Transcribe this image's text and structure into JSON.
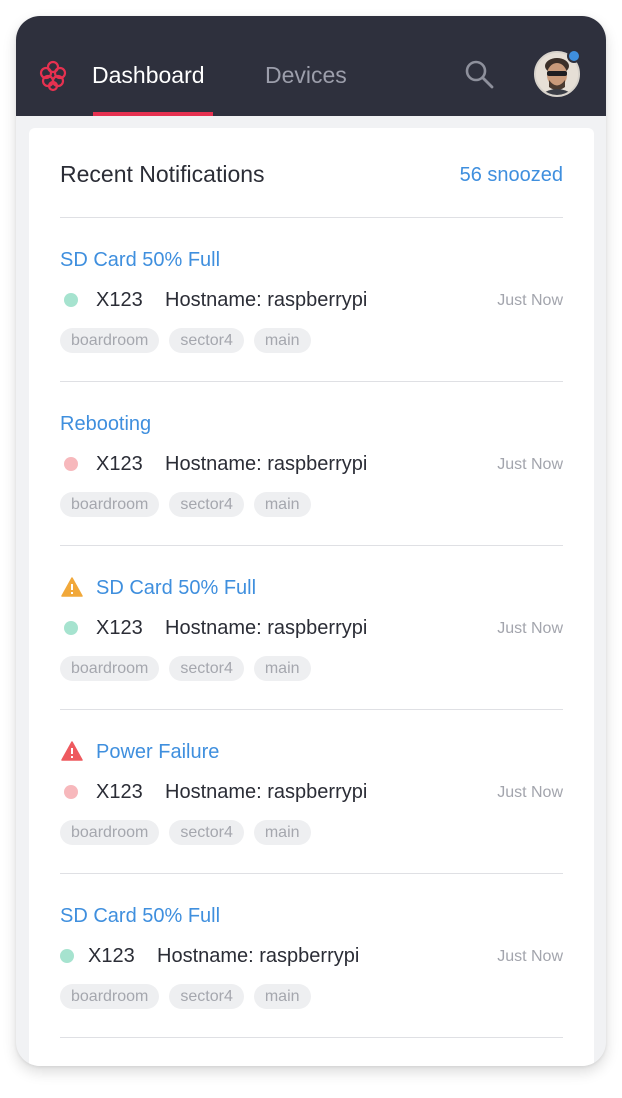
{
  "nav": {
    "tabs": [
      {
        "label": "Dashboard",
        "active": true
      },
      {
        "label": "Devices",
        "active": false
      }
    ],
    "logo_icon": "raspberry-logo-icon",
    "search_icon": "search-icon",
    "avatar_icon": "user-avatar",
    "accent_color": "#e63150",
    "notification_dot_color": "#3f8fde"
  },
  "notifications": {
    "title": "Recent Notifications",
    "snoozed_label": "56 snoozed",
    "items": [
      {
        "title": "SD Card 50% Full",
        "icon": null,
        "status": "green",
        "device_id": "X123",
        "hostname": "Hostname: raspberrypi",
        "time": "Just Now",
        "tags": [
          "boardroom",
          "sector4",
          "main"
        ]
      },
      {
        "title": "Rebooting",
        "icon": null,
        "status": "red",
        "device_id": "X123",
        "hostname": "Hostname: raspberrypi",
        "time": "Just Now",
        "tags": [
          "boardroom",
          "sector4",
          "main"
        ]
      },
      {
        "title": "SD Card 50% Full",
        "icon": "warning-icon",
        "icon_color": "#f1a83a",
        "status": "green",
        "device_id": "X123",
        "hostname": "Hostname: raspberrypi",
        "time": "Just Now",
        "tags": [
          "boardroom",
          "sector4",
          "main"
        ]
      },
      {
        "title": "Power Failure",
        "icon": "alert-icon",
        "icon_color": "#ee5a5f",
        "status": "red",
        "device_id": "X123",
        "hostname": "Hostname: raspberrypi",
        "time": "Just Now",
        "tags": [
          "boardroom",
          "sector4",
          "main"
        ]
      },
      {
        "title": "SD Card 50% Full",
        "icon": null,
        "status": "green",
        "device_id": "X123",
        "hostname": "Hostname: raspberrypi",
        "time": "Just Now",
        "tags": [
          "boardroom",
          "sector4",
          "main"
        ]
      }
    ]
  },
  "colors": {
    "link_blue": "#3f8fde",
    "status_green": "#a6e3cf",
    "status_red": "#f7b8bc",
    "topbar_bg": "#2e303d"
  }
}
